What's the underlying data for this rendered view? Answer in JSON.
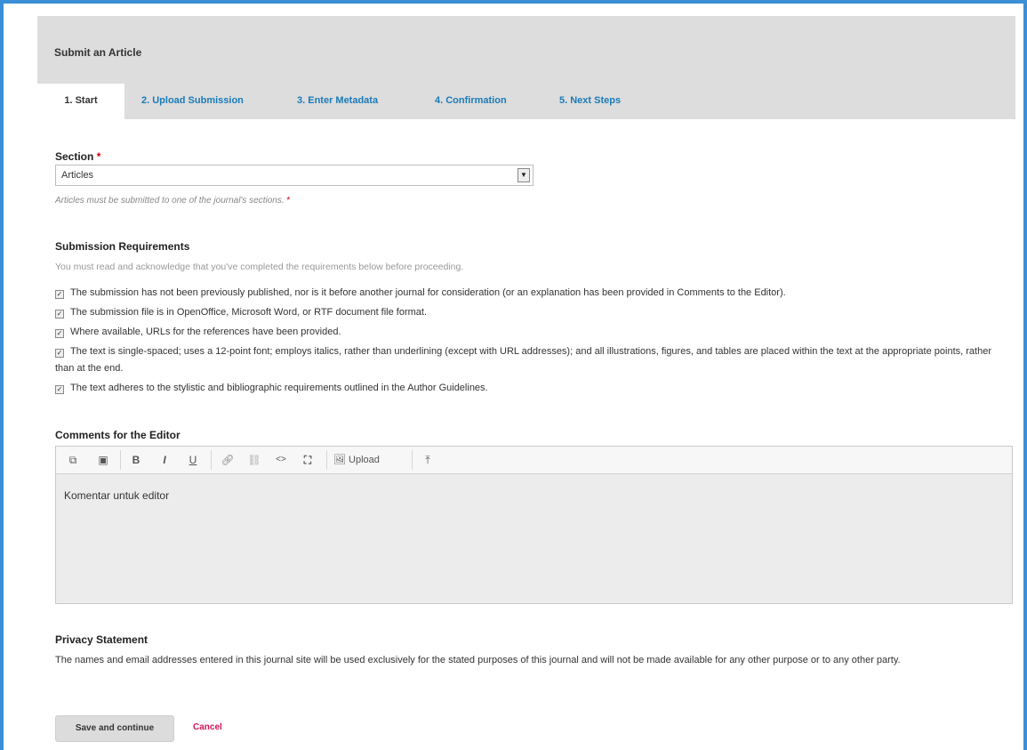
{
  "page": {
    "title": "Submit an Article",
    "tabs": [
      {
        "label": "1. Start",
        "active": true
      },
      {
        "label": "2. Upload Submission",
        "active": false
      },
      {
        "label": "3. Enter Metadata",
        "active": false
      },
      {
        "label": "4. Confirmation",
        "active": false
      },
      {
        "label": "5. Next Steps",
        "active": false
      }
    ]
  },
  "section": {
    "label": "Section",
    "required_mark": "*",
    "selected": "Articles",
    "description": "Articles must be submitted to one of the journal's sections.",
    "description_required_mark": "*"
  },
  "requirements": {
    "heading": "Submission Requirements",
    "intro": "You must read and acknowledge that you've completed the requirements below before proceeding.",
    "items": [
      {
        "text": "The submission has not been previously published, nor is it before another journal for consideration (or an explanation has been provided in Comments to the Editor).",
        "checked": true
      },
      {
        "text": "The submission file is in OpenOffice, Microsoft Word, or RTF document file format.",
        "checked": true
      },
      {
        "text": "Where available, URLs for the references have been provided.",
        "checked": true
      },
      {
        "text": "The text is single-spaced; uses a 12-point font; employs italics, rather than underlining (except with URL addresses); and all illustrations, figures, and tables are placed within the text at the appropriate points, rather than at the end.",
        "checked": true
      },
      {
        "text": "The text adheres to the stylistic and bibliographic requirements outlined in the Author Guidelines.",
        "checked": true
      }
    ]
  },
  "comments": {
    "heading": "Comments for the Editor",
    "toolbar": {
      "copy_icon": "copy-icon",
      "paste_icon": "paste-icon",
      "bold": "B",
      "italic": "I",
      "underline": "U",
      "link_icon": "link-icon",
      "unlink_icon": "unlink-icon",
      "code": "<>",
      "fullscreen_icon": "fullscreen-icon",
      "upload_label": "Upload",
      "upload_icon": "upload-icon"
    },
    "value": "Komentar untuk editor"
  },
  "privacy": {
    "heading": "Privacy Statement",
    "text": "The names and email addresses entered in this journal site will be used exclusively for the stated purposes of this journal and will not be made available for any other purpose or to any other party."
  },
  "actions": {
    "save_label": "Save and continue",
    "cancel_label": "Cancel"
  },
  "colors": {
    "frame_border": "#3a8fd6",
    "header_bg": "#dddddd",
    "tab_link": "#1a7ab8",
    "required": "#d00000",
    "cancel": "#d4145a"
  }
}
